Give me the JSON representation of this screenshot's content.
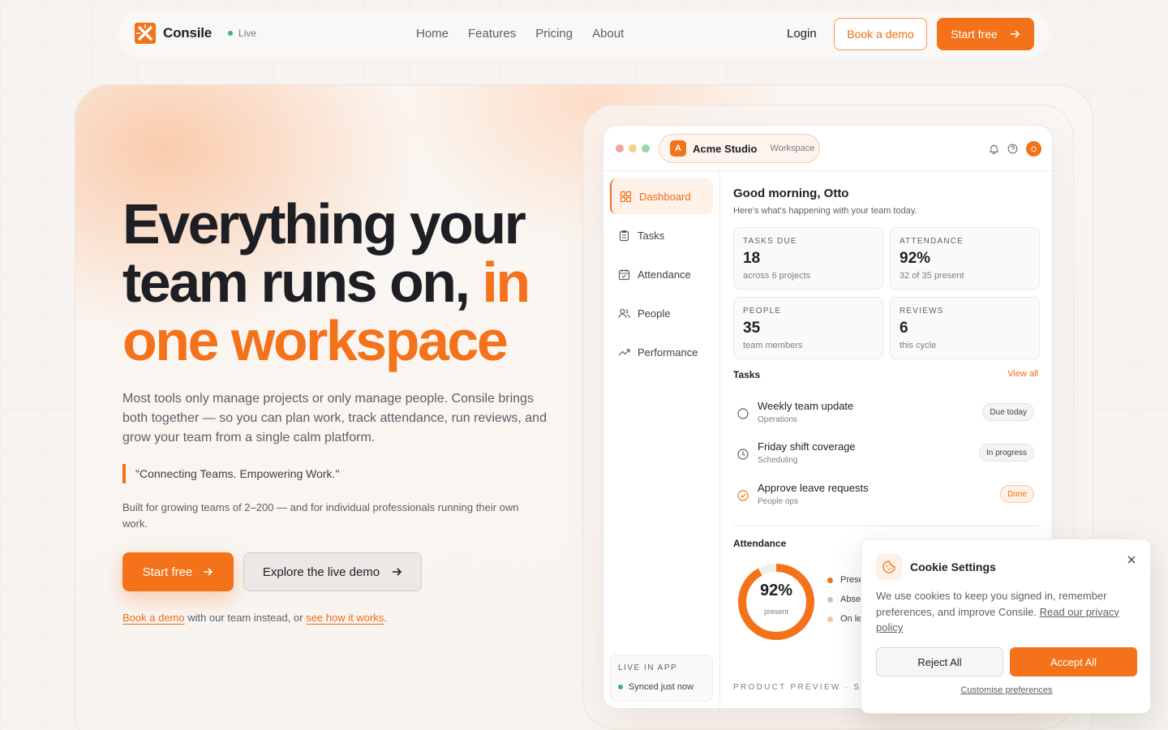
{
  "nav": {
    "brand": "Consile",
    "status": "Live",
    "links": [
      "Home",
      "Features",
      "Pricing",
      "About"
    ],
    "login": "Login",
    "book_demo": "Book a demo",
    "start_free": "Start free"
  },
  "hero": {
    "headline_part1": "Everything your team runs on, ",
    "headline_accent": "in one workspace",
    "lead": "Most tools only manage projects or only manage people. Consile brings both together — so you can plan work, track attendance, run reviews, and grow your team from a single calm platform.",
    "quote": "\"Connecting Teams. Empowering Work.\"",
    "sub": "Built for growing teams of 2–200 — and for individual professionals running their own work.",
    "cta_primary": "Start free",
    "cta_secondary": "Explore the live demo",
    "alt_link1": "Book a demo",
    "alt_mid": " with our team instead, or ",
    "alt_link2": "see how it works",
    "alt_end": "."
  },
  "app": {
    "workspace_initial": "A",
    "workspace_name": "Acme Studio",
    "workspace_tag": "Workspace",
    "user_initial": "O",
    "sidebar": [
      {
        "label": "Dashboard",
        "icon": "grid-icon",
        "active": true
      },
      {
        "label": "Tasks",
        "icon": "clipboard-icon"
      },
      {
        "label": "Attendance",
        "icon": "calendar-icon"
      },
      {
        "label": "People",
        "icon": "users-icon"
      },
      {
        "label": "Performance",
        "icon": "trend-icon"
      }
    ],
    "live_title": "LIVE IN APP",
    "live_status": "Synced just now",
    "greeting": "Good morning, Otto",
    "greeting_sub": "Here's what's happening with your team today.",
    "stats": [
      {
        "label": "TASKS DUE",
        "value": "18",
        "detail": "across 6 projects"
      },
      {
        "label": "ATTENDANCE",
        "value": "92%",
        "detail": "32 of 35 present"
      },
      {
        "label": "PEOPLE",
        "value": "35",
        "detail": "team members"
      },
      {
        "label": "REVIEWS",
        "value": "6",
        "detail": "this cycle"
      }
    ],
    "tasks_title": "Tasks",
    "view_all": "View all",
    "tasks": [
      {
        "name": "Weekly team update",
        "category": "Operations",
        "status": "Due today"
      },
      {
        "name": "Friday shift coverage",
        "category": "Scheduling",
        "status": "In progress"
      },
      {
        "name": "Approve leave requests",
        "category": "People ops",
        "status": "Done"
      }
    ],
    "attendance_title": "Attendance",
    "attendance_value": "92%",
    "attendance_fraction": 0.92,
    "attendance_label": "present",
    "legend": [
      "Prese",
      "Abse",
      "On le"
    ],
    "preview_label": "PRODUCT PREVIEW · SAM"
  },
  "cookie": {
    "title": "Cookie Settings",
    "text": "We use cookies to keep you signed in, remember preferences, and improve Consile. ",
    "link": "Read our privacy policy",
    "reject": "Reject All",
    "accept": "Accept All",
    "customise": "Customise preferences"
  },
  "colors": {
    "accent": "#f4721a",
    "live": "#37b37e"
  }
}
